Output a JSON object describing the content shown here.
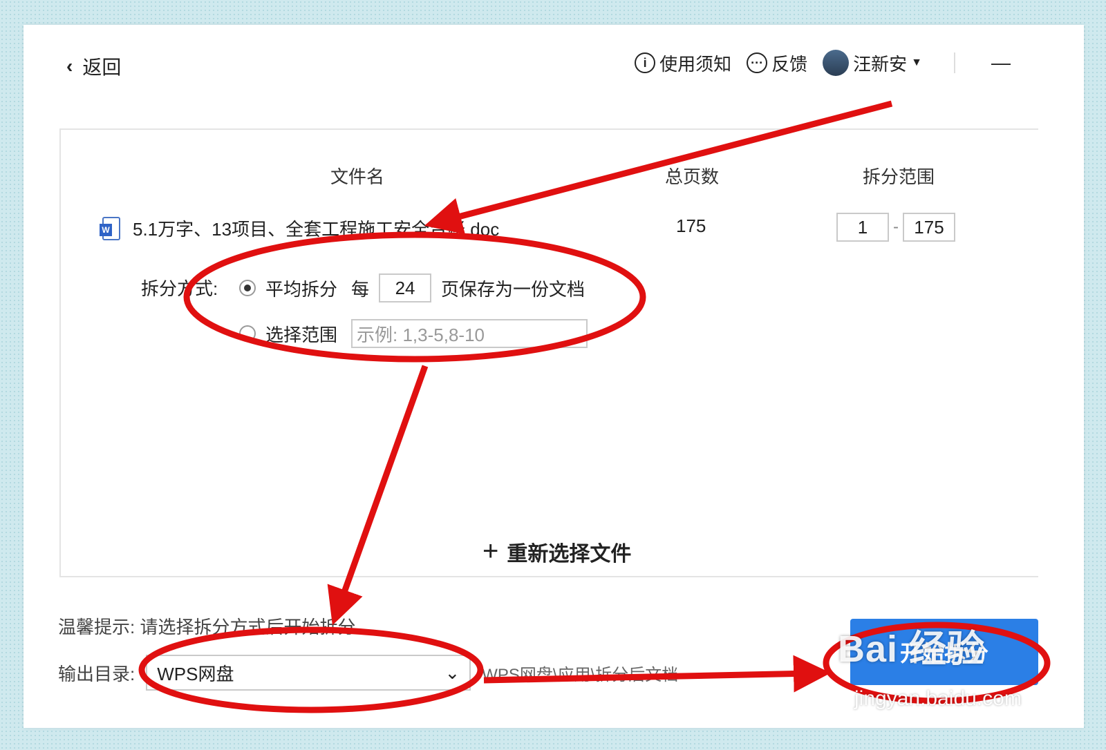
{
  "header": {
    "back_label": "返回",
    "usage_label": "使用须知",
    "feedback_label": "反馈",
    "user_name": "汪新安",
    "minimize": "—"
  },
  "table": {
    "col_filename": "文件名",
    "col_pages": "总页数",
    "col_range": "拆分范围",
    "file_name": "5.1万字、13项目、全套工程施工安全台账.doc",
    "total_pages": "175",
    "range_from": "1",
    "range_sep": "-",
    "range_to": "175"
  },
  "split": {
    "label": "拆分方式:",
    "option_even": "平均拆分",
    "per": "每",
    "per_value": "24",
    "per_suffix": "页保存为一份文档",
    "option_range": "选择范围",
    "range_placeholder": "示例:  1,3-5,8-10",
    "selected": "平均拆分"
  },
  "reselect_label": "重新选择文件",
  "footer": {
    "tip": "温馨提示:  请选择拆分方式后开始拆分",
    "output_label": "输出目录:",
    "output_value": "WPS网盘",
    "output_hint": "WPS网盘\\应用\\拆分后文档",
    "start_button": "开始拆分"
  },
  "watermark": {
    "brand": "Bai 经验",
    "url": "jingyan.baidu.com"
  },
  "colors": {
    "annotation": "#e01010",
    "button": "#2b7fe6"
  }
}
